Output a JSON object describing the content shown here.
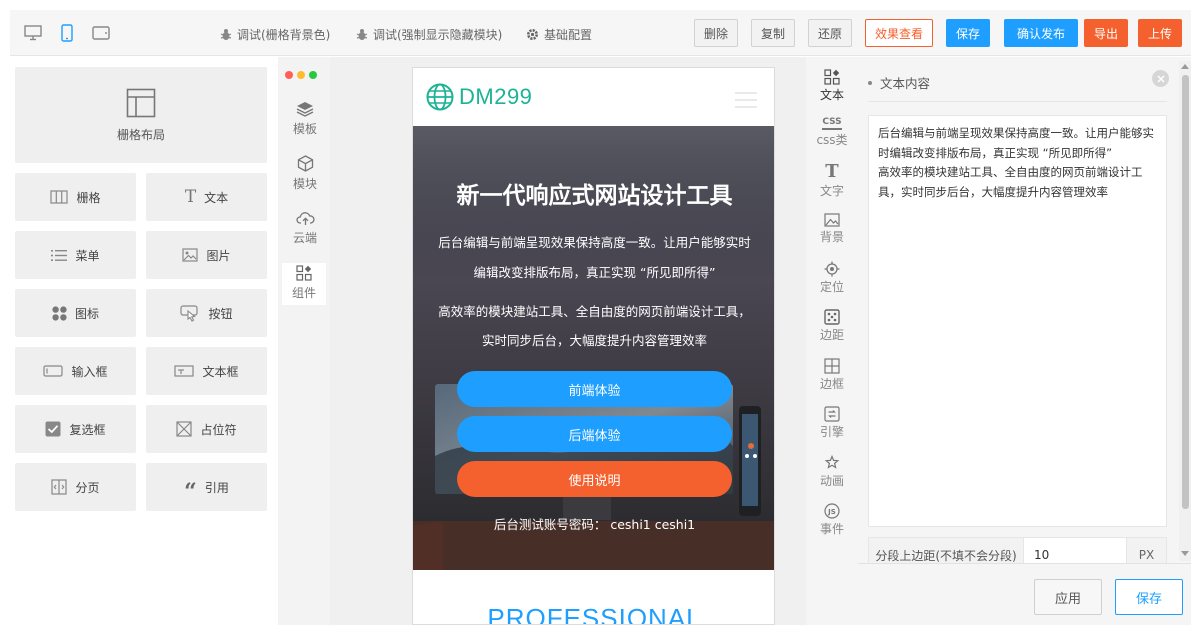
{
  "toolbar": {
    "devices": [
      "desktop-icon",
      "mobile-icon",
      "tablet-icon"
    ],
    "debug_grid": "调试(栅格背景色)",
    "debug_hidden": "调试(强制显示隐藏模块)",
    "base_config": "基础配置",
    "delete": "删除",
    "copy": "复制",
    "restore": "还原",
    "preview": "效果查看",
    "save": "保存",
    "publish": "确认发布",
    "export": "导出",
    "upload": "上传"
  },
  "components": {
    "grid_layout": "栅格布局",
    "items": [
      {
        "label": "栅格",
        "icon": "columns-icon"
      },
      {
        "label": "文本",
        "icon": "text-icon"
      },
      {
        "label": "菜单",
        "icon": "menu-icon"
      },
      {
        "label": "图片",
        "icon": "image-icon"
      },
      {
        "label": "图标",
        "icon": "icons-grid-icon"
      },
      {
        "label": "按钮",
        "icon": "button-hand-icon"
      },
      {
        "label": "输入框",
        "icon": "input-icon"
      },
      {
        "label": "文本框",
        "icon": "textarea-icon"
      },
      {
        "label": "复选框",
        "icon": "checkbox-icon"
      },
      {
        "label": "占位符",
        "icon": "placeholder-icon"
      },
      {
        "label": "分页",
        "icon": "pagination-icon"
      },
      {
        "label": "引用",
        "icon": "quote-icon"
      }
    ]
  },
  "side_tabs": [
    {
      "label": "模板",
      "icon": "layers-icon"
    },
    {
      "label": "模块",
      "icon": "cube-icon"
    },
    {
      "label": "云端",
      "icon": "cloud-upload-icon"
    },
    {
      "label": "组件",
      "icon": "widgets-icon"
    }
  ],
  "preview": {
    "logo": "DM299",
    "hero_title": "新一代响应式网站设计工具",
    "para1_line1": "后台编辑与前端呈现效果保持高度一致。让用户能够实时",
    "para1_line2": "编辑改变排版布局，真正实现 “所见即所得”",
    "para2_line1": "高效率的模块建站工具、全自由度的网页前端设计工具，",
    "para2_line2": "实时同步后台，大幅度提升内容管理效率",
    "btn_front": "前端体验",
    "btn_back": "后端体验",
    "btn_guide": "使用说明",
    "account": "后台测试账号密码： ceshi1 ceshi1",
    "section_heading": "PROFESSIONAL"
  },
  "prop_tabs": [
    {
      "label": "文本",
      "icon": "widgets-icon"
    },
    {
      "label": "css类",
      "icon": "css-icon"
    },
    {
      "label": "文字",
      "icon": "font-icon"
    },
    {
      "label": "背景",
      "icon": "background-image-icon"
    },
    {
      "label": "定位",
      "icon": "position-icon"
    },
    {
      "label": "边距",
      "icon": "padding-icon"
    },
    {
      "label": "边框",
      "icon": "border-icon"
    },
    {
      "label": "引擎",
      "icon": "engine-icon"
    },
    {
      "label": "动画",
      "icon": "animation-icon"
    },
    {
      "label": "事件",
      "icon": "js-icon"
    }
  ],
  "props": {
    "section_title": "文本内容",
    "text_line1": "后台编辑与前端呈现效果保持高度一致。让用户能够实",
    "text_line2": "时编辑改变排版布局，真正实现 “所见即所得”",
    "text_line3": "高效率的模块建站工具、全自由度的网页前端设计工",
    "text_line4": "具，实时同步后台，大幅度提升内容管理效率",
    "para_margin_label": "分段上边距(不填不会分段)",
    "para_margin_value": "10",
    "para_margin_unit": "PX",
    "apply": "应用",
    "save": "保存"
  },
  "colors": {
    "accent_blue": "#1e9fff",
    "accent_orange": "#f4612e",
    "logo_green": "#1bb394"
  }
}
